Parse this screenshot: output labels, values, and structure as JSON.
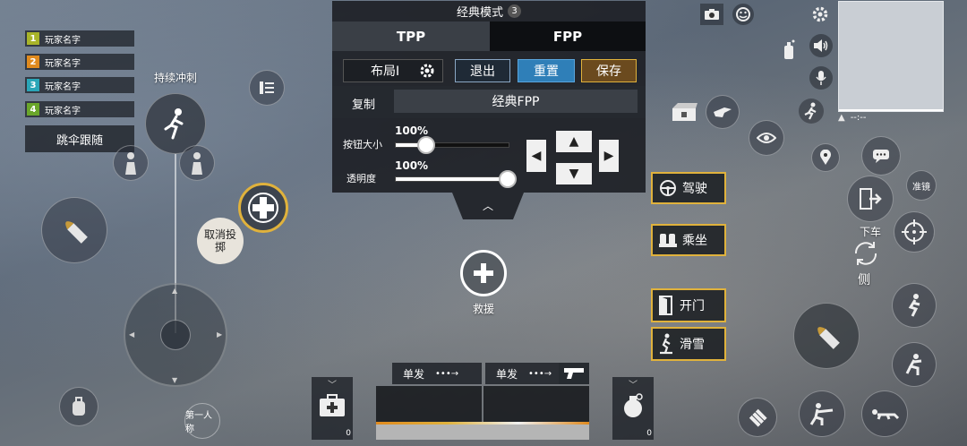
{
  "team": [
    {
      "num": "1",
      "name": "玩家名字",
      "color": "#a8b429"
    },
    {
      "num": "2",
      "name": "玩家名字",
      "color": "#e08a1e"
    },
    {
      "num": "3",
      "name": "玩家名字",
      "color": "#2aa6b8"
    },
    {
      "num": "4",
      "name": "玩家名字",
      "color": "#6aa62a"
    }
  ],
  "parachute_follow": "跳伞跟随",
  "sprint_label": "持续冲刺",
  "cancel_throw": "取消投掷",
  "first_person": "第一人称",
  "rescue": "救援",
  "panel": {
    "title": "经典模式",
    "badge": "3",
    "tab_tpp": "TPP",
    "tab_fpp": "FPP",
    "layout_label": "布局I",
    "exit": "退出",
    "reset": "重置",
    "save": "保存",
    "copy_label": "复制",
    "copy_value": "经典FPP",
    "btn_size_label": "按钮大小",
    "btn_size_value": "100%",
    "opacity_label": "透明度",
    "opacity_value": "100%",
    "btn_size_level": 1.0,
    "opacity_level": 1.0
  },
  "actions": {
    "drive": "驾驶",
    "ride": "乘坐",
    "open_door": "开门",
    "ski": "滑雪"
  },
  "get_off": "下车",
  "side": "侧",
  "aim": "准镜",
  "minimap_text": "--:--",
  "fire_mode_1": "单发",
  "fire_mode_2": "单发",
  "medkit_count": "0",
  "grenade_count": "0",
  "colors": {
    "accent": "#e0b23c",
    "blue_btn": "#2f7fb8",
    "save_btn": "#6b4a1e"
  }
}
